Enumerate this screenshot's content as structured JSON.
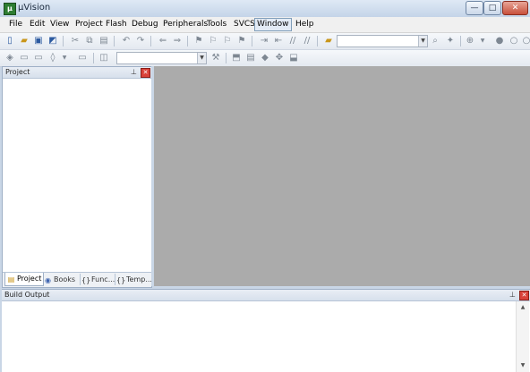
{
  "window": {
    "title": "µVision",
    "app_icon_letter": "μ",
    "minimize_glyph": "—",
    "maximize_glyph": "□",
    "close_glyph": "✕"
  },
  "menu": [
    {
      "label": "File"
    },
    {
      "label": "Edit"
    },
    {
      "label": "View"
    },
    {
      "label": "Project"
    },
    {
      "label": "Flash"
    },
    {
      "label": "Debug"
    },
    {
      "label": "Peripherals"
    },
    {
      "label": "Tools"
    },
    {
      "label": "SVCS"
    },
    {
      "label": "Window",
      "active": true
    },
    {
      "label": "Help"
    }
  ],
  "toolbar1": {
    "icons": [
      "new-file-icon",
      "open-file-icon",
      "save-icon",
      "save-all-icon",
      "cut-icon",
      "copy-icon",
      "paste-icon",
      "undo-icon",
      "redo-icon",
      "navigate-back-icon",
      "navigate-forward-icon",
      "bookmark-set-icon",
      "bookmark-prev-icon",
      "bookmark-next-icon",
      "bookmark-clear-icon",
      "indent-icon",
      "unindent-icon",
      "comment-icon",
      "uncomment-icon",
      "find-in-files-icon"
    ],
    "find_combo_value": "",
    "trailing_icons": [
      "find-icon",
      "debug-session-icon",
      "zoom-icon",
      "breakpoint-icon",
      "breakpoint-disable-icon",
      "dot-icon"
    ]
  },
  "toolbar2": {
    "icons": [
      "translate-icon",
      "build-icon",
      "rebuild-icon",
      "batch-build-icon",
      "download-icon"
    ],
    "target_combo_value": "",
    "trailing_icons": [
      "target-options-icon",
      "file-extensions-icon",
      "manage-components-icon",
      "select-packs-icon",
      "pack-installer-icon",
      "rte-icon"
    ]
  },
  "project_pane": {
    "title": "Project",
    "pin_glyph": "⊥",
    "close_glyph": "✕",
    "tabs": [
      {
        "label": "Project",
        "icon": "project-tab-icon",
        "glyph": "▤",
        "active": true
      },
      {
        "label": "Books",
        "icon": "books-tab-icon",
        "glyph": "◉",
        "active": false
      },
      {
        "label": "Func...",
        "icon": "functions-tab-icon",
        "glyph": "{}",
        "active": false
      },
      {
        "label": "Temp...",
        "icon": "templates-tab-icon",
        "glyph": "{}",
        "active": false
      }
    ]
  },
  "build_output": {
    "title": "Build Output",
    "pin_glyph": "⊥",
    "close_glyph": "✕",
    "scroll_up_glyph": "▲",
    "scroll_down_glyph": "▼"
  },
  "colors": {
    "editor_background": "#ababab",
    "frame": "#c9d6e6",
    "close_red": "#d9423a"
  }
}
